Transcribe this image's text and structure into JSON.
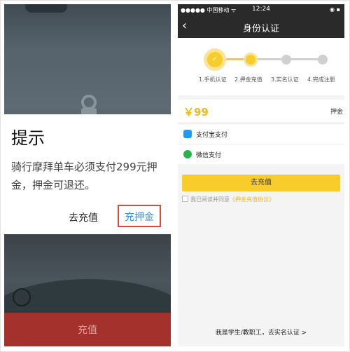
{
  "left_screen": {
    "dialog_title": "提示",
    "dialog_message": "骑行摩拜单车必须支付299元押金，押金可退还。",
    "cancel_label": "去充值",
    "confirm_label": "充押金",
    "bottom_bar_label": "充值"
  },
  "right_screen": {
    "status_bar": {
      "carrier": "●●●●● 中国移动 ᯤ",
      "time": "12:24",
      "battery": "◉ ▪"
    },
    "nav_title": "身份认证",
    "back_icon": "chevron-left-icon",
    "steps": [
      {
        "label": "1.手机认证",
        "state": "done"
      },
      {
        "label": "2.押金充值",
        "state": "current"
      },
      {
        "label": "3.实名认证",
        "state": "pending"
      },
      {
        "label": "4.完成注册",
        "state": "pending"
      }
    ],
    "amount": "￥99",
    "amount_label": "押金",
    "payment_methods": [
      {
        "label": "支付宝支付",
        "icon": "alipay-icon",
        "color": "#1d9bf0"
      },
      {
        "label": "微信支付",
        "icon": "wechat-icon",
        "color": "#2bb24c"
      }
    ],
    "charge_button": "去充值",
    "agreement_prefix": "我已阅读并同意",
    "agreement_link": "《押金充值协议》",
    "student_link": "我是学生/教职工，去实名认证 >"
  },
  "colors": {
    "accent_yellow": "#f8cc2a",
    "highlight_red": "#e0463a",
    "link_blue": "#3a8ee6"
  }
}
